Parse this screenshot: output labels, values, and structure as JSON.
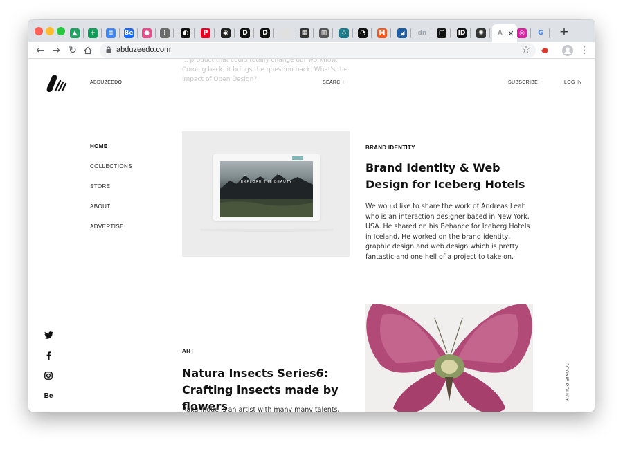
{
  "browser": {
    "url": "abduzeedo.com",
    "tabs": [
      {
        "icon": "google-drive-icon",
        "color": "#1fa463",
        "glyph": "▲"
      },
      {
        "icon": "google-sheets-icon",
        "color": "#0f9d58",
        "glyph": "+"
      },
      {
        "icon": "google-docs-icon",
        "color": "#4285f4",
        "glyph": "≡"
      },
      {
        "icon": "behance-icon",
        "color": "#1769ff",
        "glyph": "Bē"
      },
      {
        "icon": "dribbble-icon",
        "color": "#ea4c89",
        "glyph": "●"
      },
      {
        "icon": "figma-icon",
        "color": "#6b6b6b",
        "glyph": "⁞"
      },
      {
        "icon": "dark-circle-icon",
        "color": "#111111",
        "glyph": "◐"
      },
      {
        "icon": "pinterest-icon",
        "color": "#e60023",
        "glyph": "P"
      },
      {
        "icon": "record-icon",
        "color": "#222222",
        "glyph": "◉"
      },
      {
        "icon": "d-square-icon",
        "color": "#111111",
        "glyph": "D"
      },
      {
        "icon": "d-circle-icon",
        "color": "#111111",
        "glyph": "D"
      },
      {
        "icon": "blank-tab-icon",
        "color": "#e0e0e0",
        "glyph": ""
      },
      {
        "icon": "grid-icon",
        "color": "#333333",
        "glyph": "▦"
      },
      {
        "icon": "barcode-icon",
        "color": "#555555",
        "glyph": "▥"
      },
      {
        "icon": "diamond-icon",
        "color": "#1b7b8a",
        "glyph": "◇"
      },
      {
        "icon": "spiral-icon",
        "color": "#111111",
        "glyph": "◔"
      },
      {
        "icon": "orange-badge-icon",
        "color": "#ef5b24",
        "glyph": "M"
      },
      {
        "icon": "blue-slash-icon",
        "color": "#1d5fa7",
        "glyph": "◢"
      },
      {
        "icon": "dn-icon",
        "color": "#9aa3ab",
        "glyph": "dn"
      },
      {
        "icon": "square-icon",
        "color": "#111111",
        "glyph": "▢"
      },
      {
        "icon": "id-icon",
        "color": "#111111",
        "glyph": "ID"
      },
      {
        "icon": "star-burst-icon",
        "color": "#333333",
        "glyph": "✺"
      },
      {
        "icon": "active-tab-icon",
        "color": "#999999",
        "glyph": "A"
      },
      {
        "icon": "instagram-icon",
        "color": "#d6249f",
        "glyph": "◎"
      },
      {
        "icon": "google-icon",
        "color": "#4285f4",
        "glyph": "G"
      }
    ]
  },
  "header": {
    "brand": "ABDUZEEDO",
    "search": "SEARCH",
    "subscribe": "SUBSCRIBE",
    "login": "LOG IN"
  },
  "ghost_text": "... product that could totally change our workflow. Coming back, it brings the question back. What's the impact of Open Design?",
  "sidebar": {
    "items": [
      {
        "label": "HOME"
      },
      {
        "label": "COLLECTIONS"
      },
      {
        "label": "STORE"
      },
      {
        "label": "ABOUT"
      },
      {
        "label": "ADVERTISE"
      }
    ]
  },
  "social": {
    "behance_label": "Be"
  },
  "articles": [
    {
      "category": "BRAND IDENTITY",
      "title": "Brand Identity & Web Design for Iceberg Hotels",
      "excerpt": "We would like to share the work of Andreas Leah who is an interaction designer based in New York, USA. He shared on his Behance for Iceberg Hotels in Iceland. He worked on the brand identity, graphic design and web design which is pretty fantastic and one hell of a project to take on.",
      "image_caption": "EXPLORE THE BEAUTY"
    },
    {
      "category": "ART",
      "title": "Natura Insects Series6: Crafting insects made by flowers",
      "excerpt": "Raku Inoue is an artist with many many talents, the last time we have featured him on ABDZ. His Instagram has been blowing up ever since with many articles about his"
    }
  ],
  "cookie_policy": "COOKIE POLICY"
}
